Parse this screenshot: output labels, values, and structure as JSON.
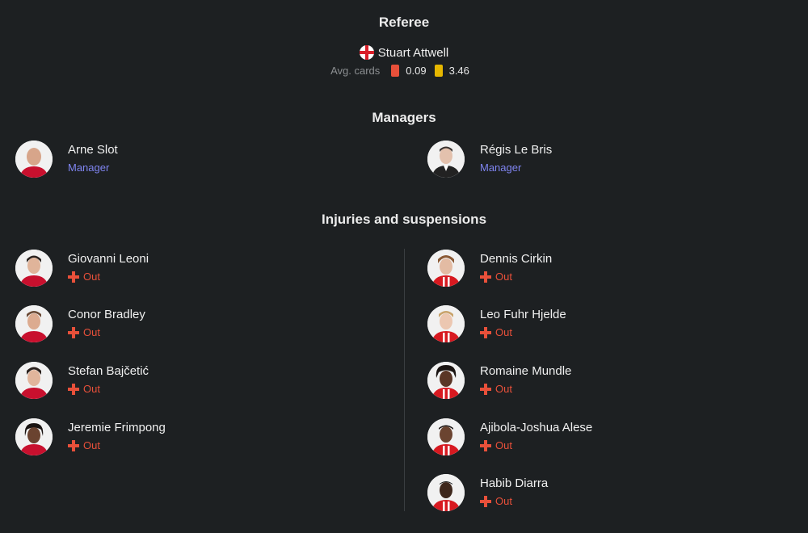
{
  "referee": {
    "title": "Referee",
    "name": "Stuart Attwell",
    "flag_icon": "england-flag-icon",
    "avg_cards_label": "Avg. cards",
    "red_avg": "0.09",
    "yellow_avg": "3.46",
    "red_color": "#e8503a",
    "yellow_color": "#e6b700"
  },
  "managers": {
    "title": "Managers",
    "home": {
      "name": "Arne Slot",
      "role": "Manager"
    },
    "away": {
      "name": "Régis Le Bris",
      "role": "Manager"
    }
  },
  "injuries": {
    "title": "Injuries and suspensions",
    "home": [
      {
        "name": "Giovanni Leoni",
        "status": "Out"
      },
      {
        "name": "Conor Bradley",
        "status": "Out"
      },
      {
        "name": "Stefan Bajčetić",
        "status": "Out"
      },
      {
        "name": "Jeremie Frimpong",
        "status": "Out"
      }
    ],
    "away": [
      {
        "name": "Dennis Cirkin",
        "status": "Out"
      },
      {
        "name": "Leo Fuhr Hjelde",
        "status": "Out"
      },
      {
        "name": "Romaine Mundle",
        "status": "Out"
      },
      {
        "name": "Ajibola-Joshua Alese",
        "status": "Out"
      },
      {
        "name": "Habib Diarra",
        "status": "Out"
      }
    ]
  },
  "colors": {
    "manager_role": "#7f84f0",
    "status_out": "#e8503a",
    "background": "#1d2022"
  }
}
